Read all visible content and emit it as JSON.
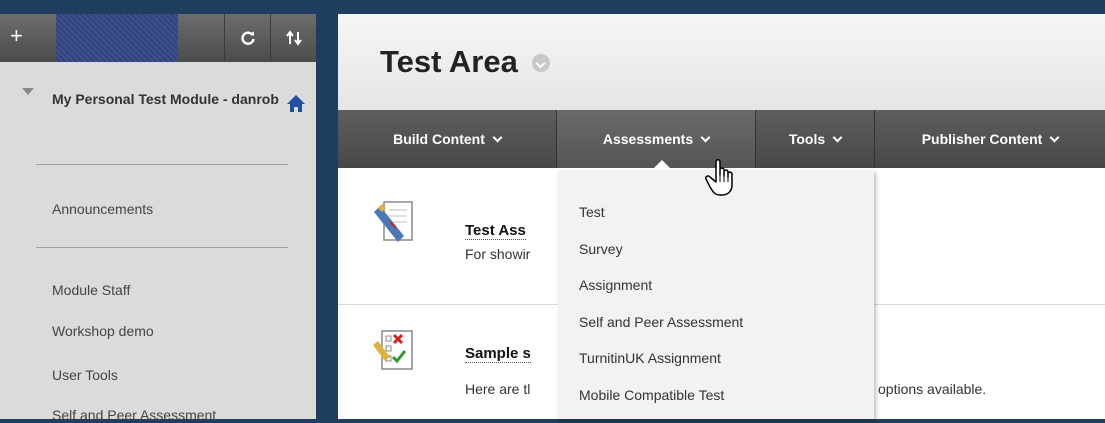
{
  "sidebar": {
    "toolbar": {
      "add_label": "+"
    },
    "module_title": "My Personal Test Module - danrob",
    "items": [
      {
        "label": "Announcements"
      },
      {
        "label": "Module Staff"
      },
      {
        "label": "Workshop demo"
      },
      {
        "label": "User Tools"
      },
      {
        "label": "Self and Peer Assessment"
      }
    ]
  },
  "header": {
    "title": "Test Area"
  },
  "actionbar": {
    "items": [
      {
        "label": "Build Content"
      },
      {
        "label": "Assessments"
      },
      {
        "label": "Tools"
      },
      {
        "label": "Publisher Content"
      }
    ]
  },
  "content": {
    "items": [
      {
        "title": "Test Ass",
        "description": "For showir",
        "icon": "test-icon"
      },
      {
        "title": "Sample s",
        "description": "Here are tl",
        "description_tail": "options available.",
        "icon": "survey-icon"
      }
    ]
  },
  "dropdown": {
    "items": [
      {
        "label": "Test"
      },
      {
        "label": "Survey"
      },
      {
        "label": "Assignment"
      },
      {
        "label": "Self and Peer Assessment"
      },
      {
        "label": "TurnitinUK Assignment"
      },
      {
        "label": "Mobile Compatible Test"
      }
    ]
  },
  "colors": {
    "sidebar_bg": "#1f3d5e",
    "sidebar_panel": "#dbdbdb",
    "actionbar": "#4f4f4f",
    "dropdown_bg": "#f2f2f2"
  }
}
